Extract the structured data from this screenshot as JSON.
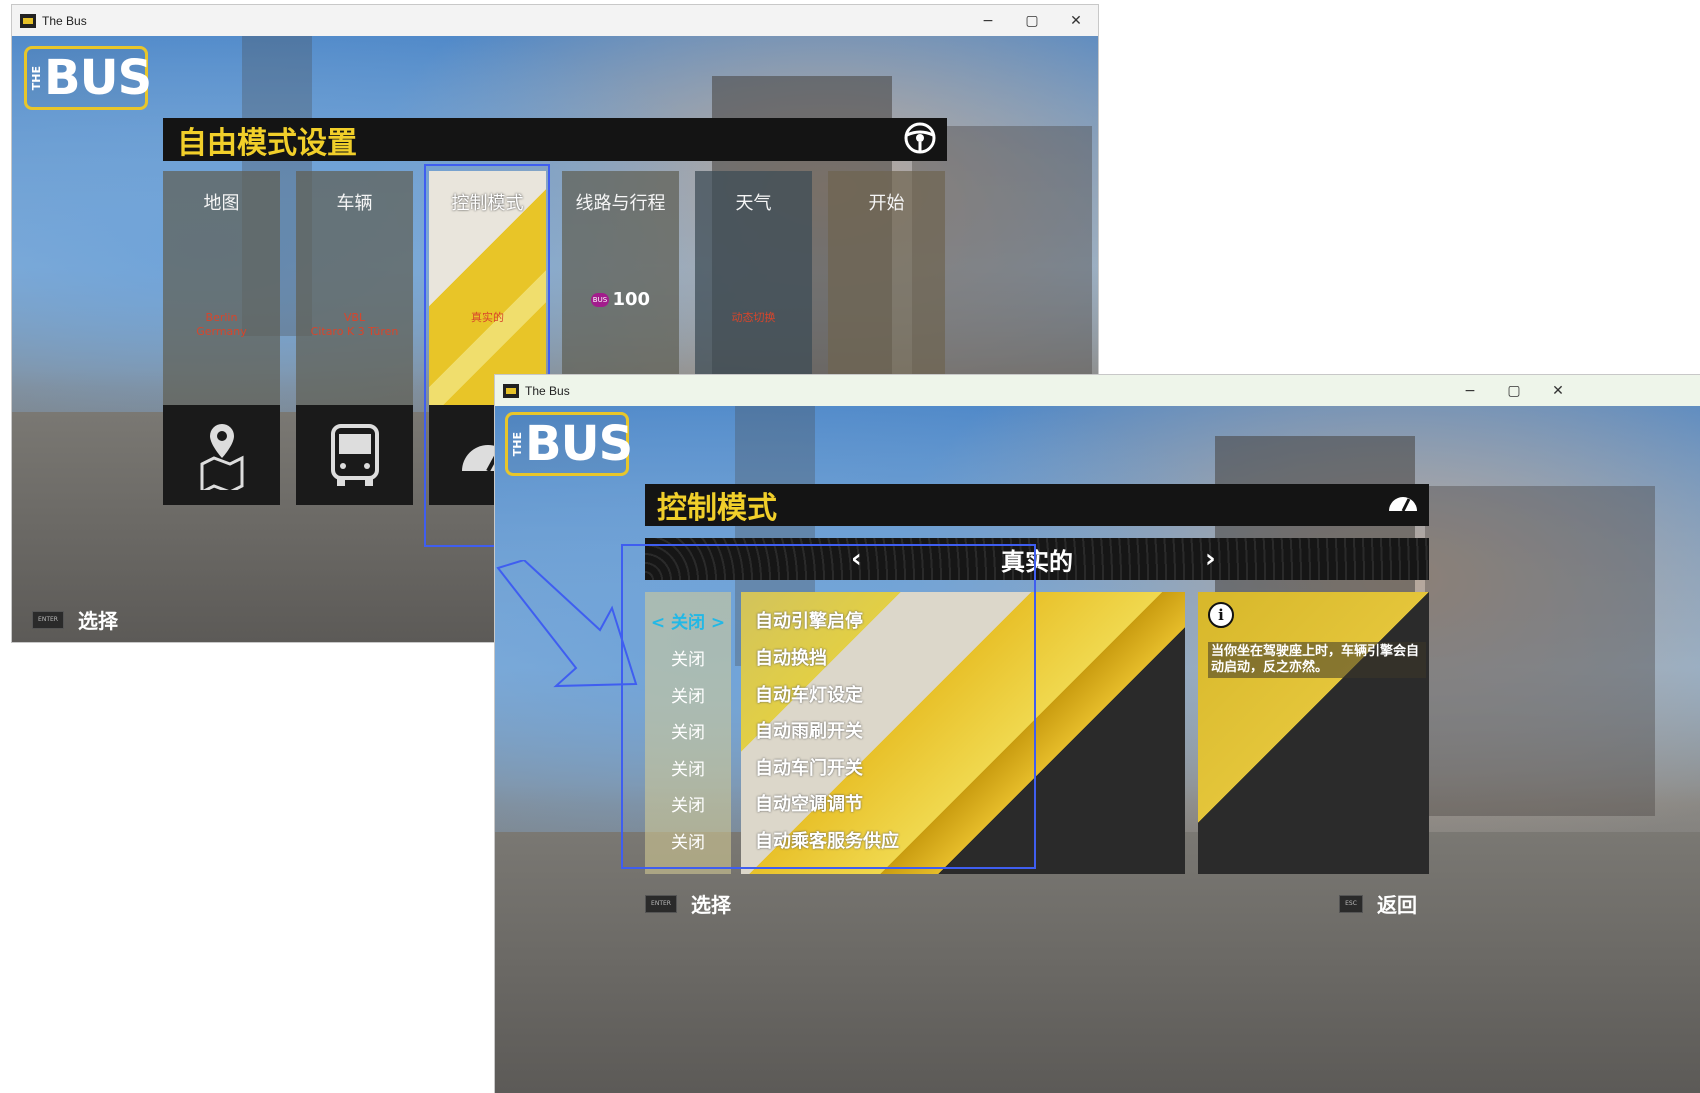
{
  "window1": {
    "title": "The Bus",
    "controls": {
      "minimize": "−",
      "maximize": "▢",
      "close": "✕"
    },
    "logo": {
      "the": "THE",
      "bus": "BUS"
    },
    "header": {
      "title": "自由模式设置",
      "icon": "steering-wheel-icon"
    },
    "cards": [
      {
        "label": "地图",
        "value_line1": "Berlin",
        "value_line2": "Germany",
        "icon": "map-pin-icon"
      },
      {
        "label": "车辆",
        "value_line1": "VBL",
        "value_line2": "Citaro K 3 Türen",
        "icon": "bus-front-icon"
      },
      {
        "label": "控制模式",
        "value_line1": "真实的",
        "value_line2": "",
        "icon": "gauge-icon"
      },
      {
        "label": "线路与行程",
        "value_line1": "100",
        "value_line2": "",
        "icon": "bus-badge-icon"
      },
      {
        "label": "天气",
        "value_line1": "动态切换",
        "value_line2": "",
        "icon": ""
      },
      {
        "label": "开始",
        "value_line1": "",
        "value_line2": "",
        "icon": ""
      }
    ],
    "footer": {
      "key": "ENTER",
      "label": "选择"
    }
  },
  "window2": {
    "title": "The Bus",
    "controls": {
      "minimize": "−",
      "maximize": "▢",
      "close": "✕"
    },
    "logo": {
      "the": "THE",
      "bus": "BUS"
    },
    "header": {
      "title": "控制模式",
      "icon": "gauge-icon"
    },
    "mode": {
      "value": "真实的",
      "prev": "‹",
      "next": "›"
    },
    "rows": [
      {
        "state": "< 关闭 >",
        "label": "自动引擎启停",
        "current": true
      },
      {
        "state": "关闭",
        "label": "自动换挡",
        "current": false
      },
      {
        "state": "关闭",
        "label": "自动车灯设定",
        "current": false
      },
      {
        "state": "关闭",
        "label": "自动雨刷开关",
        "current": false
      },
      {
        "state": "关闭",
        "label": "自动车门开关",
        "current": false
      },
      {
        "state": "关闭",
        "label": "自动空调调节",
        "current": false
      },
      {
        "state": "关闭",
        "label": "自动乘客服务供应",
        "current": false
      }
    ],
    "info": {
      "icon": "info-icon",
      "symbol": "i",
      "text": "当你坐在驾驶座上时，车辆引擎会自动启动，反之亦然。"
    },
    "footer": {
      "select_key": "ENTER",
      "select_label": "选择",
      "back_key": "ESC",
      "back_label": "返回"
    }
  },
  "colors": {
    "accent": "#f1cf2a",
    "highlight": "#3f5ef0",
    "current_state": "#22b8e6"
  }
}
